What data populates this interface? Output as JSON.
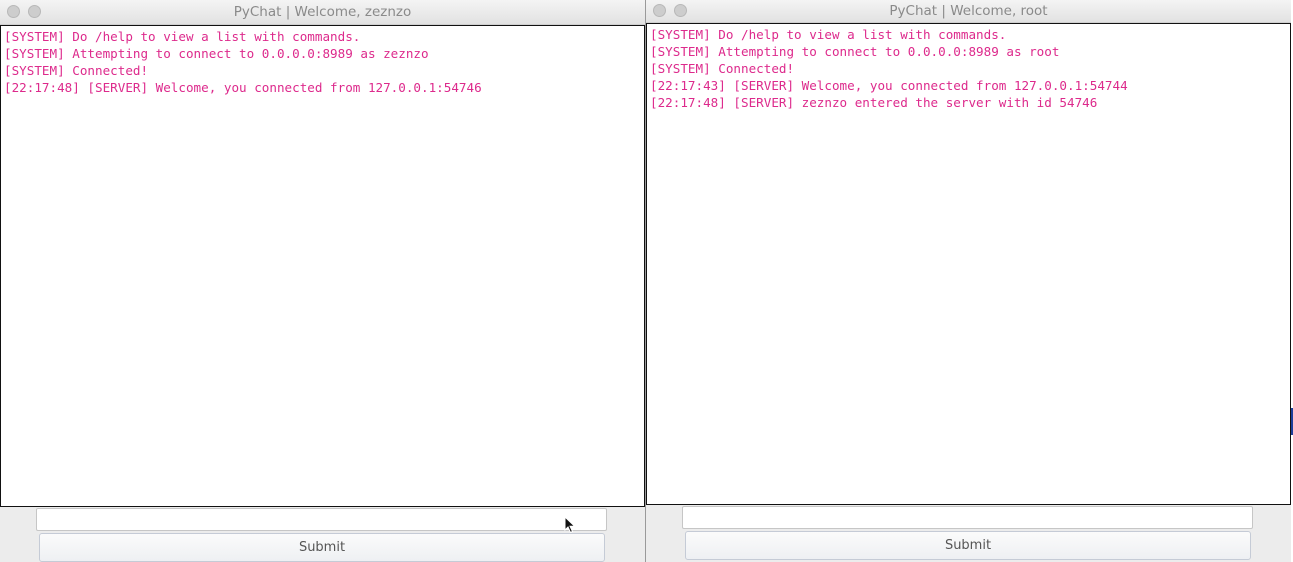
{
  "windows": [
    {
      "title": "PyChat | Welcome, zeznzo",
      "messages": [
        "[SYSTEM] Do /help to view a list with commands.",
        "[SYSTEM] Attempting to connect to 0.0.0.0:8989 as zeznzo",
        "[SYSTEM] Connected!",
        "[22:17:48] [SERVER] Welcome, you connected from 127.0.0.1:54746"
      ],
      "input_value": "",
      "submit_label": "Submit"
    },
    {
      "title": "PyChat | Welcome, root",
      "messages": [
        "[SYSTEM] Do /help to view a list with commands.",
        "[SYSTEM] Attempting to connect to 0.0.0.0:8989 as root",
        "[SYSTEM] Connected!",
        "[22:17:43] [SERVER] Welcome, you connected from 127.0.0.1:54744",
        "[22:17:48] [SERVER] zeznzo entered the server with id 54746"
      ],
      "input_value": "",
      "submit_label": "Submit"
    }
  ],
  "icons": {
    "close": "close-button-icon",
    "minimize": "minimize-button-icon",
    "cursor": "mouse-pointer-icon"
  },
  "colors": {
    "message_text": "#dd2a8c",
    "title_text": "#8a8a8a",
    "desktop_edge": "#1d3f9a"
  }
}
